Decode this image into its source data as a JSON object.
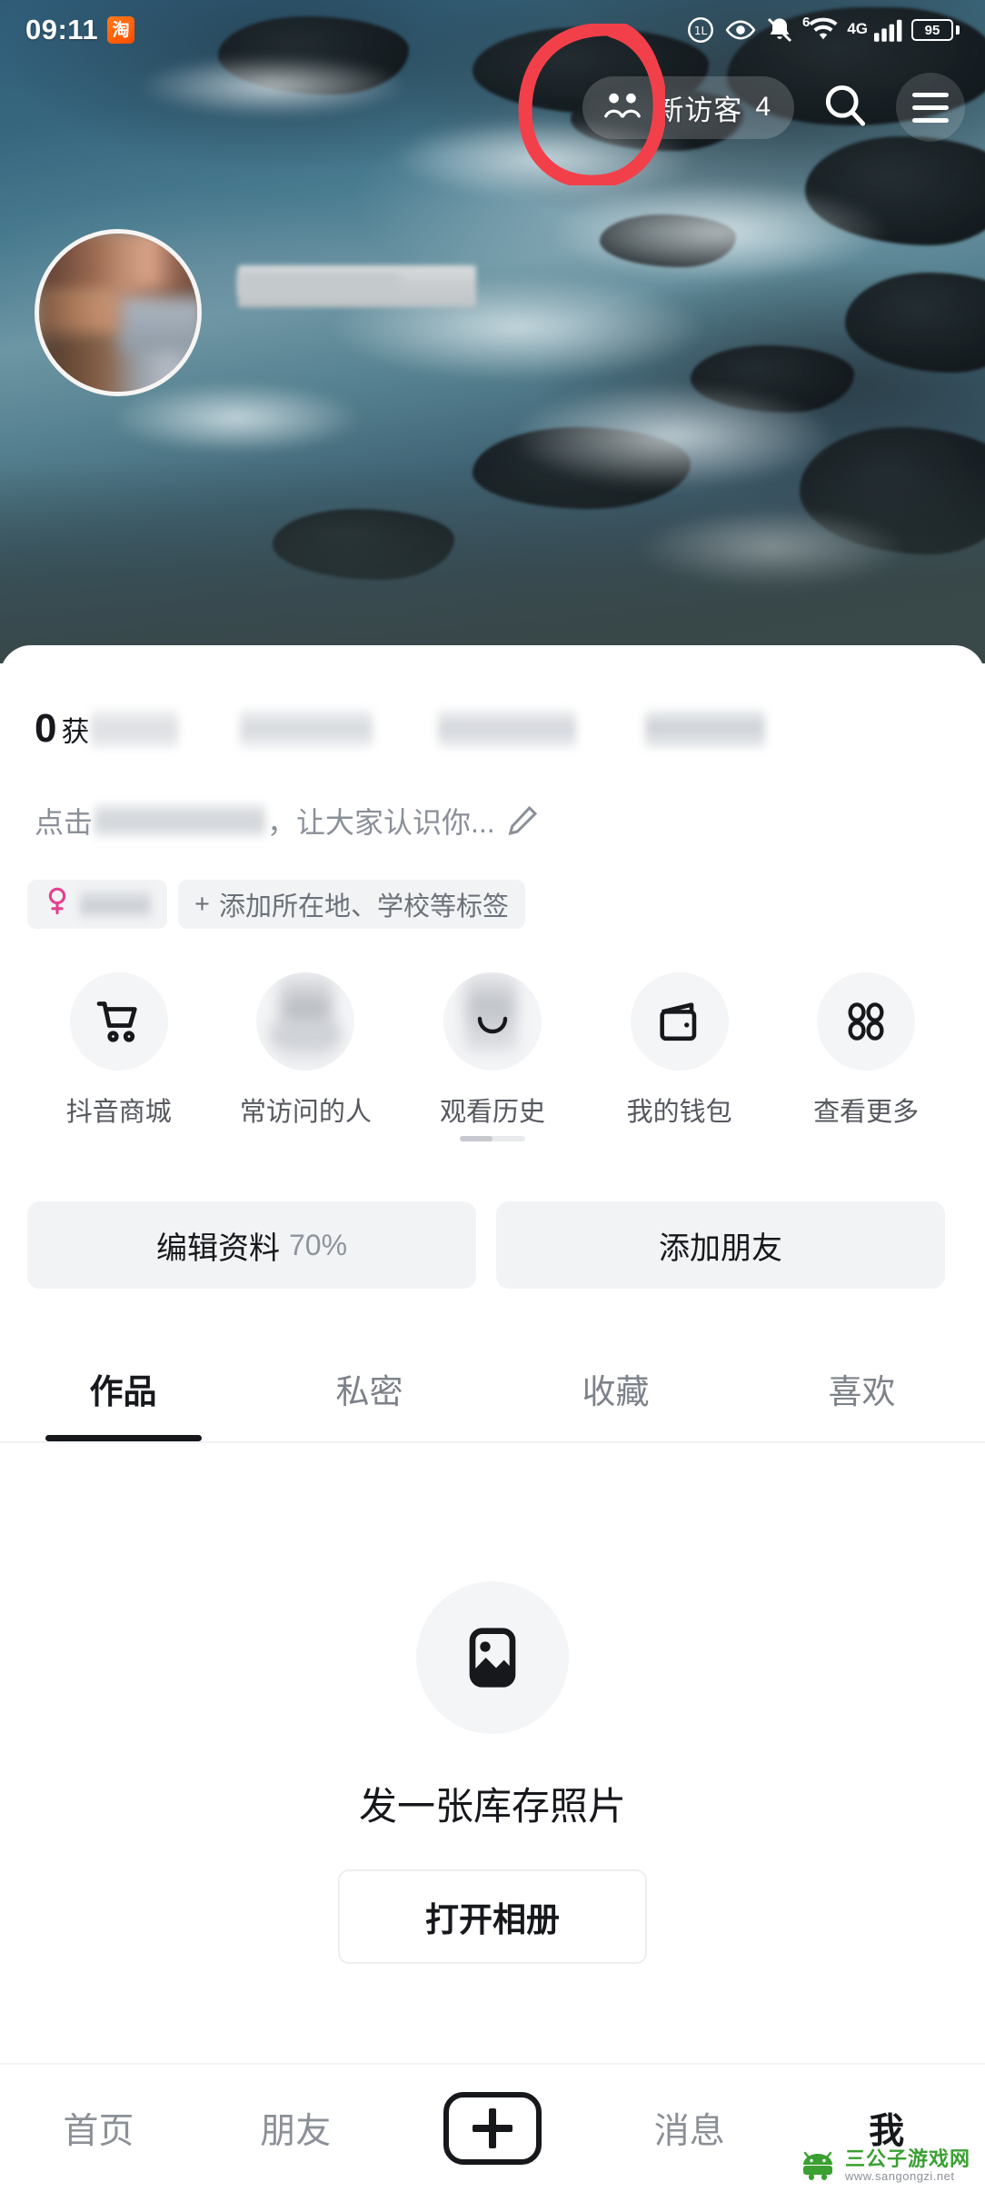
{
  "status_bar": {
    "time": "09:11",
    "taobao_badge": "淘",
    "icons": [
      "one-l-circle-icon",
      "eye-icon",
      "bell-muted-icon",
      "wifi6-icon",
      "4g-icon",
      "signal-bars-icon"
    ],
    "wifi_sup": "6",
    "network": "4G",
    "battery_percent": "95"
  },
  "hero": {
    "visitors_label": "新访客",
    "visitors_count": "4",
    "search_icon": "search-icon",
    "menu_icon": "hamburger-menu-icon",
    "annotation": "red-circle-highlight"
  },
  "profile": {
    "stats_leading_value": "0",
    "stats_leading_label": "获",
    "bio_prefix": "点击",
    "bio_suffix": "，让大家认识你...",
    "edit_icon": "pencil-icon",
    "gender_icon": "female-gender-icon",
    "add_tag_label": "添加所在地、学校等标签",
    "add_tag_plus": "+"
  },
  "shortcuts": [
    {
      "label": "抖音商城",
      "icon": "shopping-cart-icon"
    },
    {
      "label": "常访问的人",
      "icon": "frequent-visitors-icon"
    },
    {
      "label": "观看历史",
      "icon": "watch-history-icon"
    },
    {
      "label": "我的钱包",
      "icon": "wallet-icon"
    },
    {
      "label": "查看更多",
      "icon": "grid-more-icon"
    }
  ],
  "actions": {
    "edit_profile_label": "编辑资料",
    "edit_profile_percent": "70%",
    "add_friend_label": "添加朋友"
  },
  "tabs": [
    {
      "label": "作品",
      "active": true
    },
    {
      "label": "私密",
      "active": false
    },
    {
      "label": "收藏",
      "active": false
    },
    {
      "label": "喜欢",
      "active": false
    }
  ],
  "empty_state": {
    "icon": "image-placeholder-icon",
    "title": "发一张库存照片",
    "button_label": "打开相册"
  },
  "bottom_nav": [
    {
      "label": "首页",
      "active": false
    },
    {
      "label": "朋友",
      "active": false
    },
    {
      "label": "+",
      "active": false,
      "icon": "plus-create-icon"
    },
    {
      "label": "消息",
      "active": false
    },
    {
      "label": "我",
      "active": true
    }
  ],
  "watermark": {
    "site_name": "三公子游戏网",
    "url": "www.sangongzi.net",
    "logo": "android-robot-logo"
  },
  "colors": {
    "accent_dark": "#16181c",
    "muted_text": "#8b9097",
    "chip_bg": "#f2f3f5",
    "annotation_red": "#f2404a",
    "gender_pink": "#e5408f",
    "watermark_green": "#3aa032"
  }
}
